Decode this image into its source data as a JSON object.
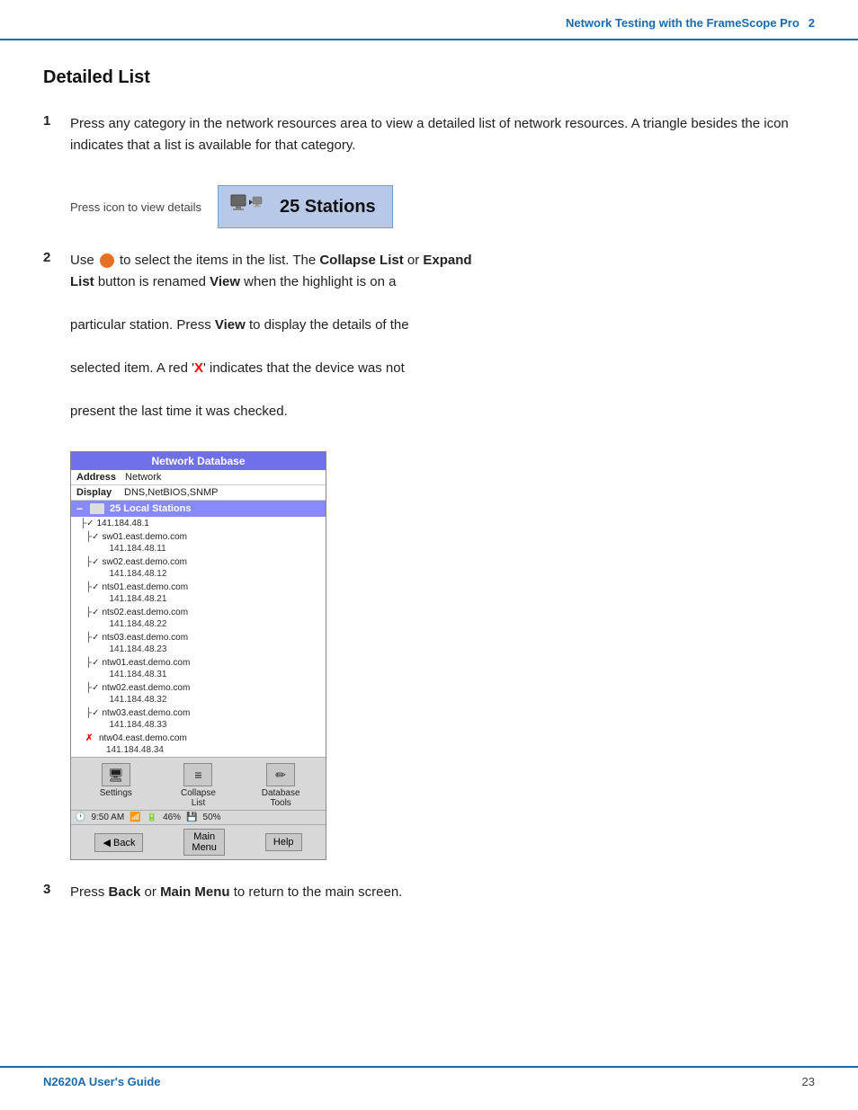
{
  "header": {
    "title": "Network Testing with the FrameScope Pro",
    "chapter": "2"
  },
  "section": {
    "title": "Detailed List"
  },
  "steps": [
    {
      "number": "1",
      "text": "Press any category in the network resources area to view a detailed list of network resources. A triangle besides the icon indicates that a list is available for that category."
    },
    {
      "number": "2",
      "text_before": "Use",
      "text_middle": " to select the items in the list. The ",
      "bold1": "Collapse List",
      "text_or": " or ",
      "bold2": "Expand List",
      "text_after": " button is renamed ",
      "bold3": "View",
      "text_cont": " when the highlight is on a particular station. Press ",
      "bold4": "View",
      "text_end": " to display the details of the selected item. A red '",
      "bold5": "X",
      "text_final": "' indicates that the device was not present the last time it was checked."
    },
    {
      "number": "3",
      "text_before": "Press ",
      "bold1": "Back",
      "text_or": " or ",
      "bold2": "Main Menu",
      "text_after": " to return to the main screen."
    }
  ],
  "illustration": {
    "press_label": "Press icon to view details",
    "stations_count": "25 Stations"
  },
  "db_screenshot": {
    "title": "Network Database",
    "row1_label": "Address",
    "row1_value": "Network",
    "row2_label": "Display",
    "row2_value": "DNS,NetBIOS,SNMP",
    "stations_row": "25 Local Stations",
    "entries": [
      {
        "indent": 1,
        "check": "✓",
        "name": "141.184.48.1",
        "ip": ""
      },
      {
        "indent": 2,
        "check": "✓",
        "name": "sw01.east.demo.com",
        "ip": "141.184.48.11"
      },
      {
        "indent": 2,
        "check": "✓",
        "name": "sw02.east.demo.com",
        "ip": "141.184.48.12"
      },
      {
        "indent": 2,
        "check": "✓",
        "name": "nts01.east.demo.com",
        "ip": "141.184.48.21"
      },
      {
        "indent": 2,
        "check": "✓",
        "name": "nts02.east.demo.com",
        "ip": "141.184.48.22"
      },
      {
        "indent": 2,
        "check": "✓",
        "name": "nts03.east.demo.com",
        "ip": "141.184.48.23"
      },
      {
        "indent": 2,
        "check": "✓",
        "name": "ntw01.east.demo.com",
        "ip": "141.184.48.31"
      },
      {
        "indent": 2,
        "check": "✓",
        "name": "ntw02.east.demo.com",
        "ip": "141.184.48.32"
      },
      {
        "indent": 2,
        "check": "✓",
        "name": "ntw03.east.demo.com",
        "ip": "141.184.48.33"
      },
      {
        "indent": 2,
        "check": "✗",
        "name": "ntw04.east.demo.com",
        "ip": "141.184.48.34"
      }
    ],
    "buttons": [
      {
        "label": "Settings",
        "icon": "🖥"
      },
      {
        "label": "Collapse\nList",
        "icon": "≡"
      },
      {
        "label": "Database\nTools",
        "icon": "✏"
      }
    ],
    "status": "9:50 AM",
    "battery": "46%",
    "nav_buttons": [
      "Back",
      "Main\nMenu",
      "Help"
    ]
  },
  "footer": {
    "left": "N2620A User's Guide",
    "right": "23"
  }
}
